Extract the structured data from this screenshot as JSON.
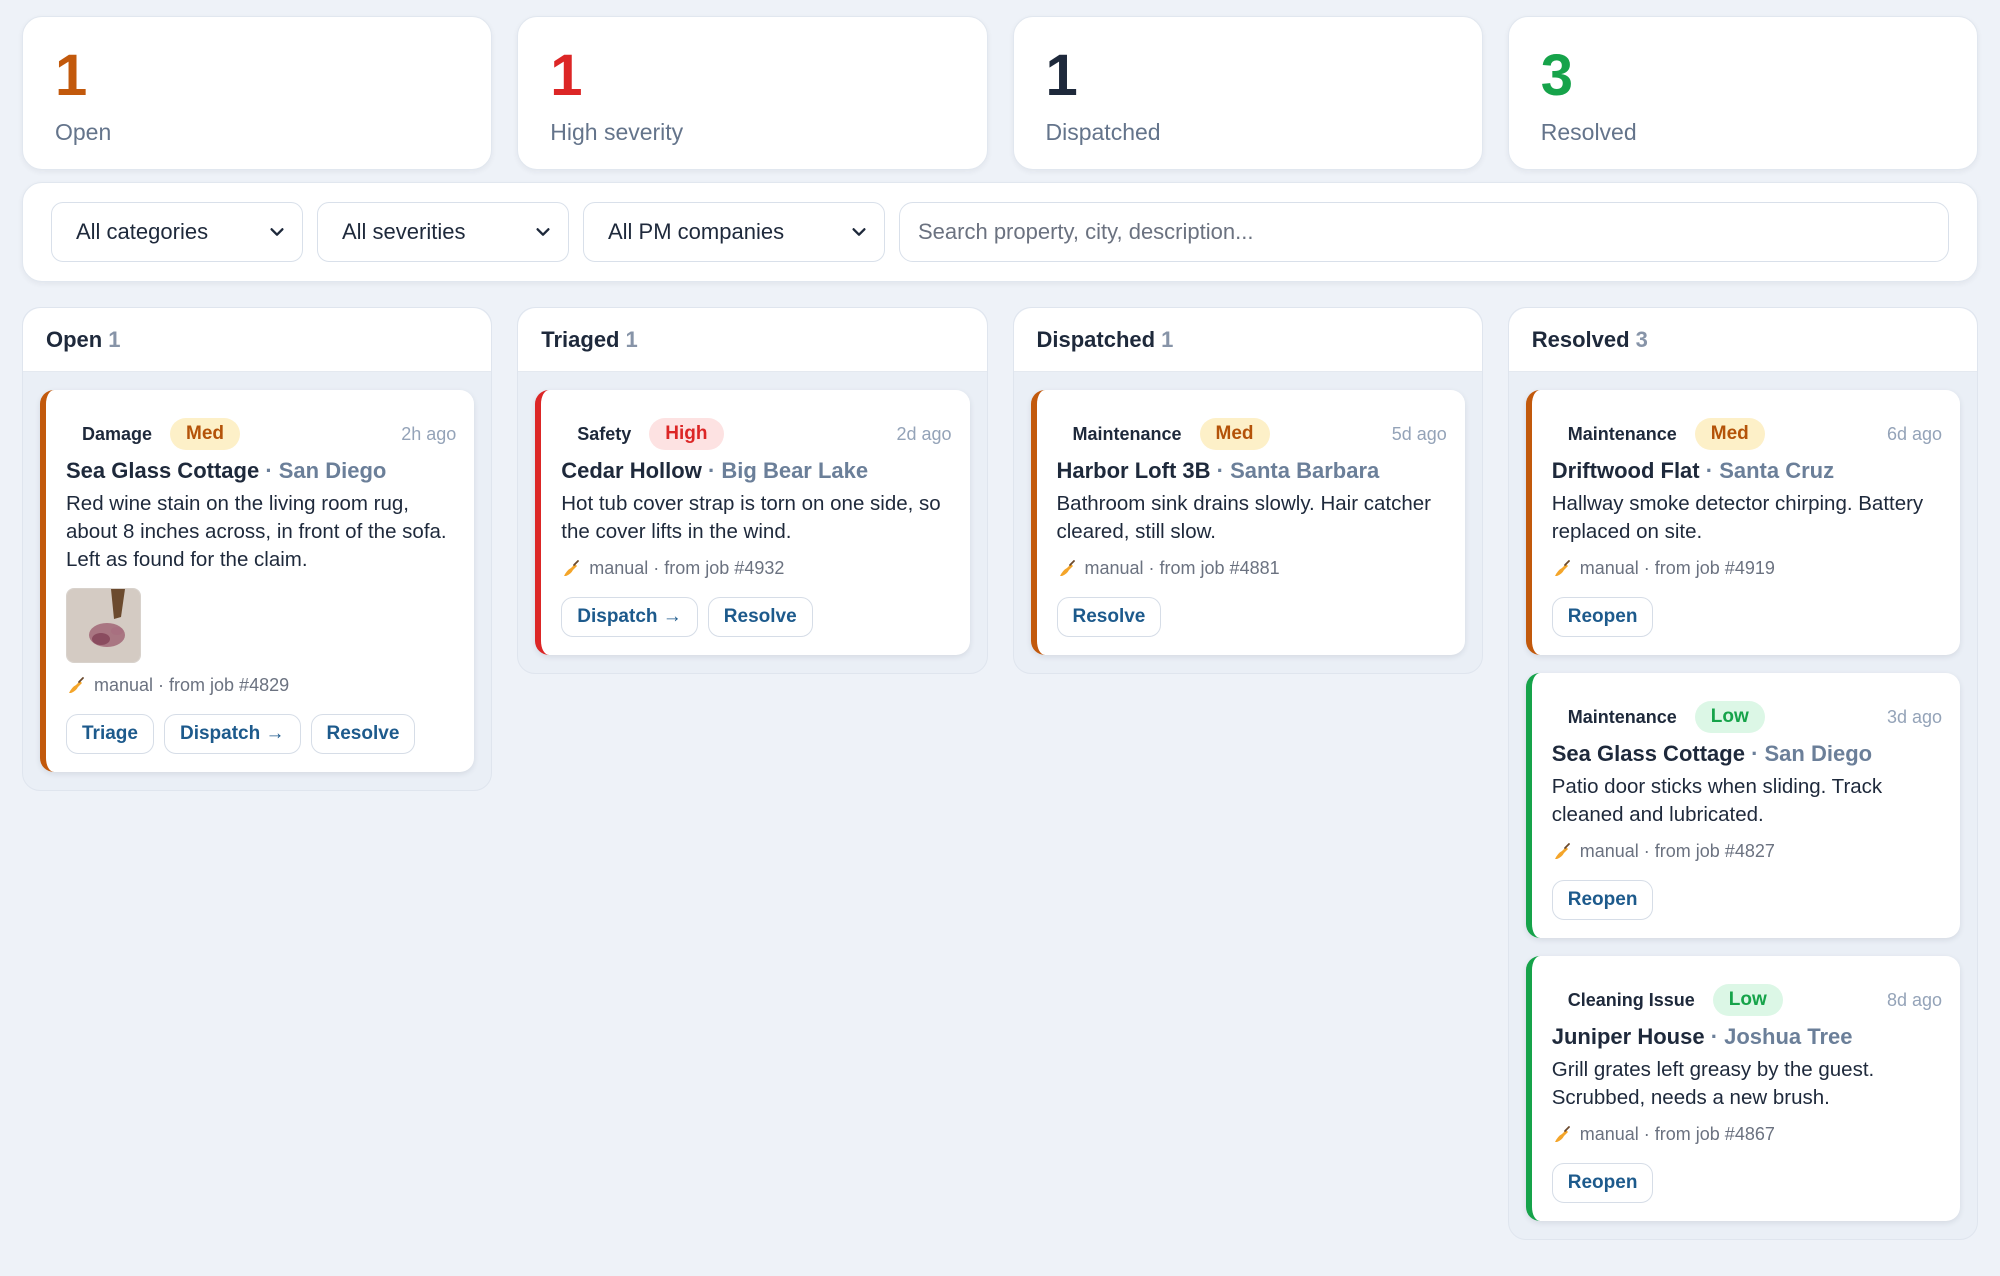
{
  "stats": [
    {
      "value": "1",
      "label": "Open",
      "color": "#c2590c"
    },
    {
      "value": "1",
      "label": "High severity",
      "color": "#dc2626"
    },
    {
      "value": "1",
      "label": "Dispatched",
      "color": "#1e293b"
    },
    {
      "value": "3",
      "label": "Resolved",
      "color": "#16a34a"
    }
  ],
  "filters": {
    "category": "All categories",
    "severity": "All severities",
    "pm_company": "All PM companies",
    "search_placeholder": "Search property, city, description..."
  },
  "columns": [
    {
      "title": "Open",
      "count": "1"
    },
    {
      "title": "Triaged",
      "count": "1"
    },
    {
      "title": "Dispatched",
      "count": "1"
    },
    {
      "title": "Resolved",
      "count": "3"
    }
  ],
  "cards": {
    "open_0": {
      "category": "Damage",
      "severity": "Med",
      "age": "2h ago",
      "property": "Sea Glass Cottage",
      "city": "· San Diego",
      "description": "Red wine stain on the living room rug, about 8 inches across, in front of the sofa. Left as found for the claim.",
      "meta": "manual · from job #4829",
      "actions": [
        "Triage",
        "Dispatch →",
        "Resolve"
      ]
    },
    "triaged_0": {
      "category": "Safety",
      "severity": "High",
      "age": "2d ago",
      "property": "Cedar Hollow",
      "city": "· Big Bear Lake",
      "description": "Hot tub cover strap is torn on one side, so the cover lifts in the wind.",
      "meta": "manual · from job #4932",
      "actions": [
        "Dispatch →",
        "Resolve"
      ]
    },
    "dispatched_0": {
      "category": "Maintenance",
      "severity": "Med",
      "age": "5d ago",
      "property": "Harbor Loft 3B",
      "city": "· Santa Barbara",
      "description": "Bathroom sink drains slowly. Hair catcher cleared, still slow.",
      "meta": "manual · from job #4881",
      "actions": [
        "Resolve"
      ]
    },
    "resolved_0": {
      "category": "Maintenance",
      "severity": "Med",
      "age": "6d ago",
      "property": "Driftwood Flat",
      "city": "· Santa Cruz",
      "description": "Hallway smoke detector chirping. Battery replaced on site.",
      "meta": "manual · from job #4919",
      "actions": [
        "Reopen"
      ]
    },
    "resolved_1": {
      "category": "Maintenance",
      "severity": "Low",
      "age": "3d ago",
      "property": "Sea Glass Cottage",
      "city": "· San Diego",
      "description": "Patio door sticks when sliding. Track cleaned and lubricated.",
      "meta": "manual · from job #4827",
      "actions": [
        "Reopen"
      ]
    },
    "resolved_2": {
      "category": "Cleaning Issue",
      "severity": "Low",
      "age": "8d ago",
      "property": "Juniper House",
      "city": "· Joshua Tree",
      "description": "Grill grates left greasy by the guest. Scrubbed, needs a new brush.",
      "meta": "manual · from job #4867",
      "actions": [
        "Reopen"
      ]
    }
  },
  "colors": {
    "open_accent": "#c2590c",
    "high_accent": "#dc2626",
    "low_accent": "#16a34a",
    "button_text": "#1d5a8c"
  },
  "icons": {
    "chevron": "chevron-down-icon",
    "meta": "writing-hand-icon"
  }
}
